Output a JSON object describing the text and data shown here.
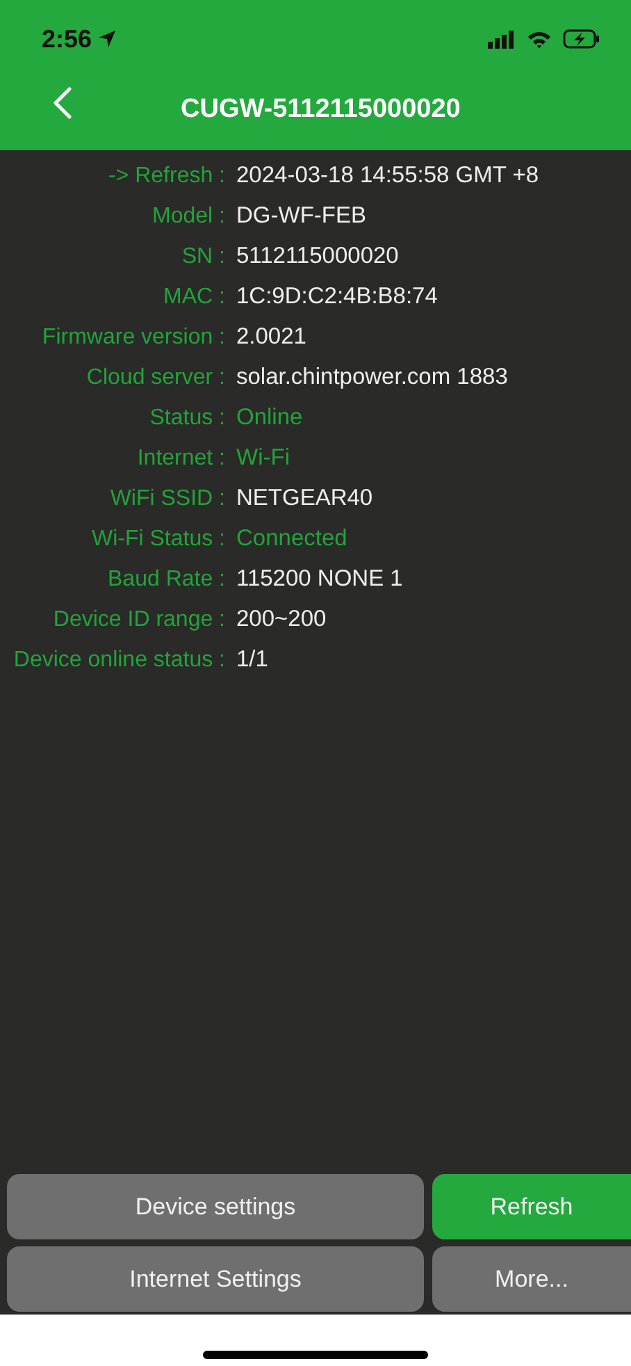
{
  "status_bar": {
    "time": "2:56"
  },
  "header": {
    "title": "CUGW-5112115000020"
  },
  "fields": [
    {
      "label": "-> Refresh :",
      "value": "2024-03-18 14:55:58 GMT +8",
      "kind": "text"
    },
    {
      "label": "Model :",
      "value": "DG-WF-FEB",
      "kind": "text"
    },
    {
      "label": "SN :",
      "value": "5112115000020",
      "kind": "text"
    },
    {
      "label": "MAC :",
      "value": "1C:9D:C2:4B:B8:74",
      "kind": "text"
    },
    {
      "label": "Firmware version :",
      "value": "2.0021",
      "kind": "text"
    },
    {
      "label": "Cloud server :",
      "value": "solar.chintpower.com 1883",
      "kind": "text"
    },
    {
      "label": "Status :",
      "value": "Online",
      "kind": "state"
    },
    {
      "label": "Internet :",
      "value": "Wi-Fi",
      "kind": "state"
    },
    {
      "label": "WiFi SSID :",
      "value": "NETGEAR40",
      "kind": "text"
    },
    {
      "label": "Wi-Fi Status :",
      "value": "Connected",
      "kind": "state"
    },
    {
      "label": "Baud Rate :",
      "value": "115200 NONE 1",
      "kind": "text"
    },
    {
      "label": "Device ID range :",
      "value": "200~200",
      "kind": "text"
    },
    {
      "label": "Device online status :",
      "value": "1/1",
      "kind": "text"
    }
  ],
  "buttons": [
    {
      "label": "Device settings",
      "kind": "secondary"
    },
    {
      "label": "Refresh",
      "kind": "primary"
    },
    {
      "label": "Internet Settings",
      "kind": "secondary"
    },
    {
      "label": "More...",
      "kind": "secondary"
    }
  ]
}
